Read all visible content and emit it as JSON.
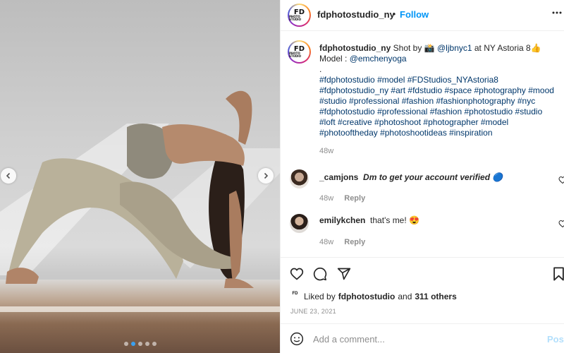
{
  "post": {
    "carousel": {
      "slide_count": 5,
      "active_slide": 2
    }
  },
  "header": {
    "username": "fdphotostudio_ny",
    "separator": "•",
    "follow_label": "Follow",
    "more_icon": "more-horizontal-icon",
    "avatar_text_top": "FD",
    "avatar_text_bottom": "PHOTO STUDIO"
  },
  "caption": {
    "username": "fdphotostudio_ny",
    "text_before_credit": " Shot by ",
    "camera_emoji": "📸",
    "credit_mention": "@ljbnyc1",
    "text_after_credit": " at NY Astoria 8👍",
    "model_prefix": "Model : ",
    "model_mention": "@emchenyoga",
    "dot_line": ".",
    "hashtags": "#fdphotostudio #model #FDStudios_NYAstoria8 #fdphotostudio_ny #art #fdstudio #space #photography #mood #studio #professional #fashion #fashionphotography #nyc #fdphotostudio #professional #fashion #photostudio #studio #loft #creative #photoshoot #photographer #model #photooftheday #photoshootideas #inspiration",
    "age": "48w"
  },
  "comments": [
    {
      "username": "_camjons",
      "text": "Dm to get your account verified 🔵",
      "age": "48w",
      "reply_label": "Reply"
    },
    {
      "username": "emilykchen",
      "text": "that's me! 😍",
      "age": "48w",
      "reply_label": "Reply"
    }
  ],
  "actions": {
    "liked_by_prefix": "Liked by",
    "liked_by_user": "fdphotostudio",
    "liked_by_conj": "and",
    "liked_by_others": "311 others",
    "date": "JUNE 23, 2021"
  },
  "add_comment": {
    "placeholder": "Add a comment...",
    "post_label": "Post"
  },
  "colors": {
    "accent": "#0095f6",
    "link": "#00376b",
    "muted": "#8e8e8e",
    "post_disabled": "#b2dffc"
  }
}
